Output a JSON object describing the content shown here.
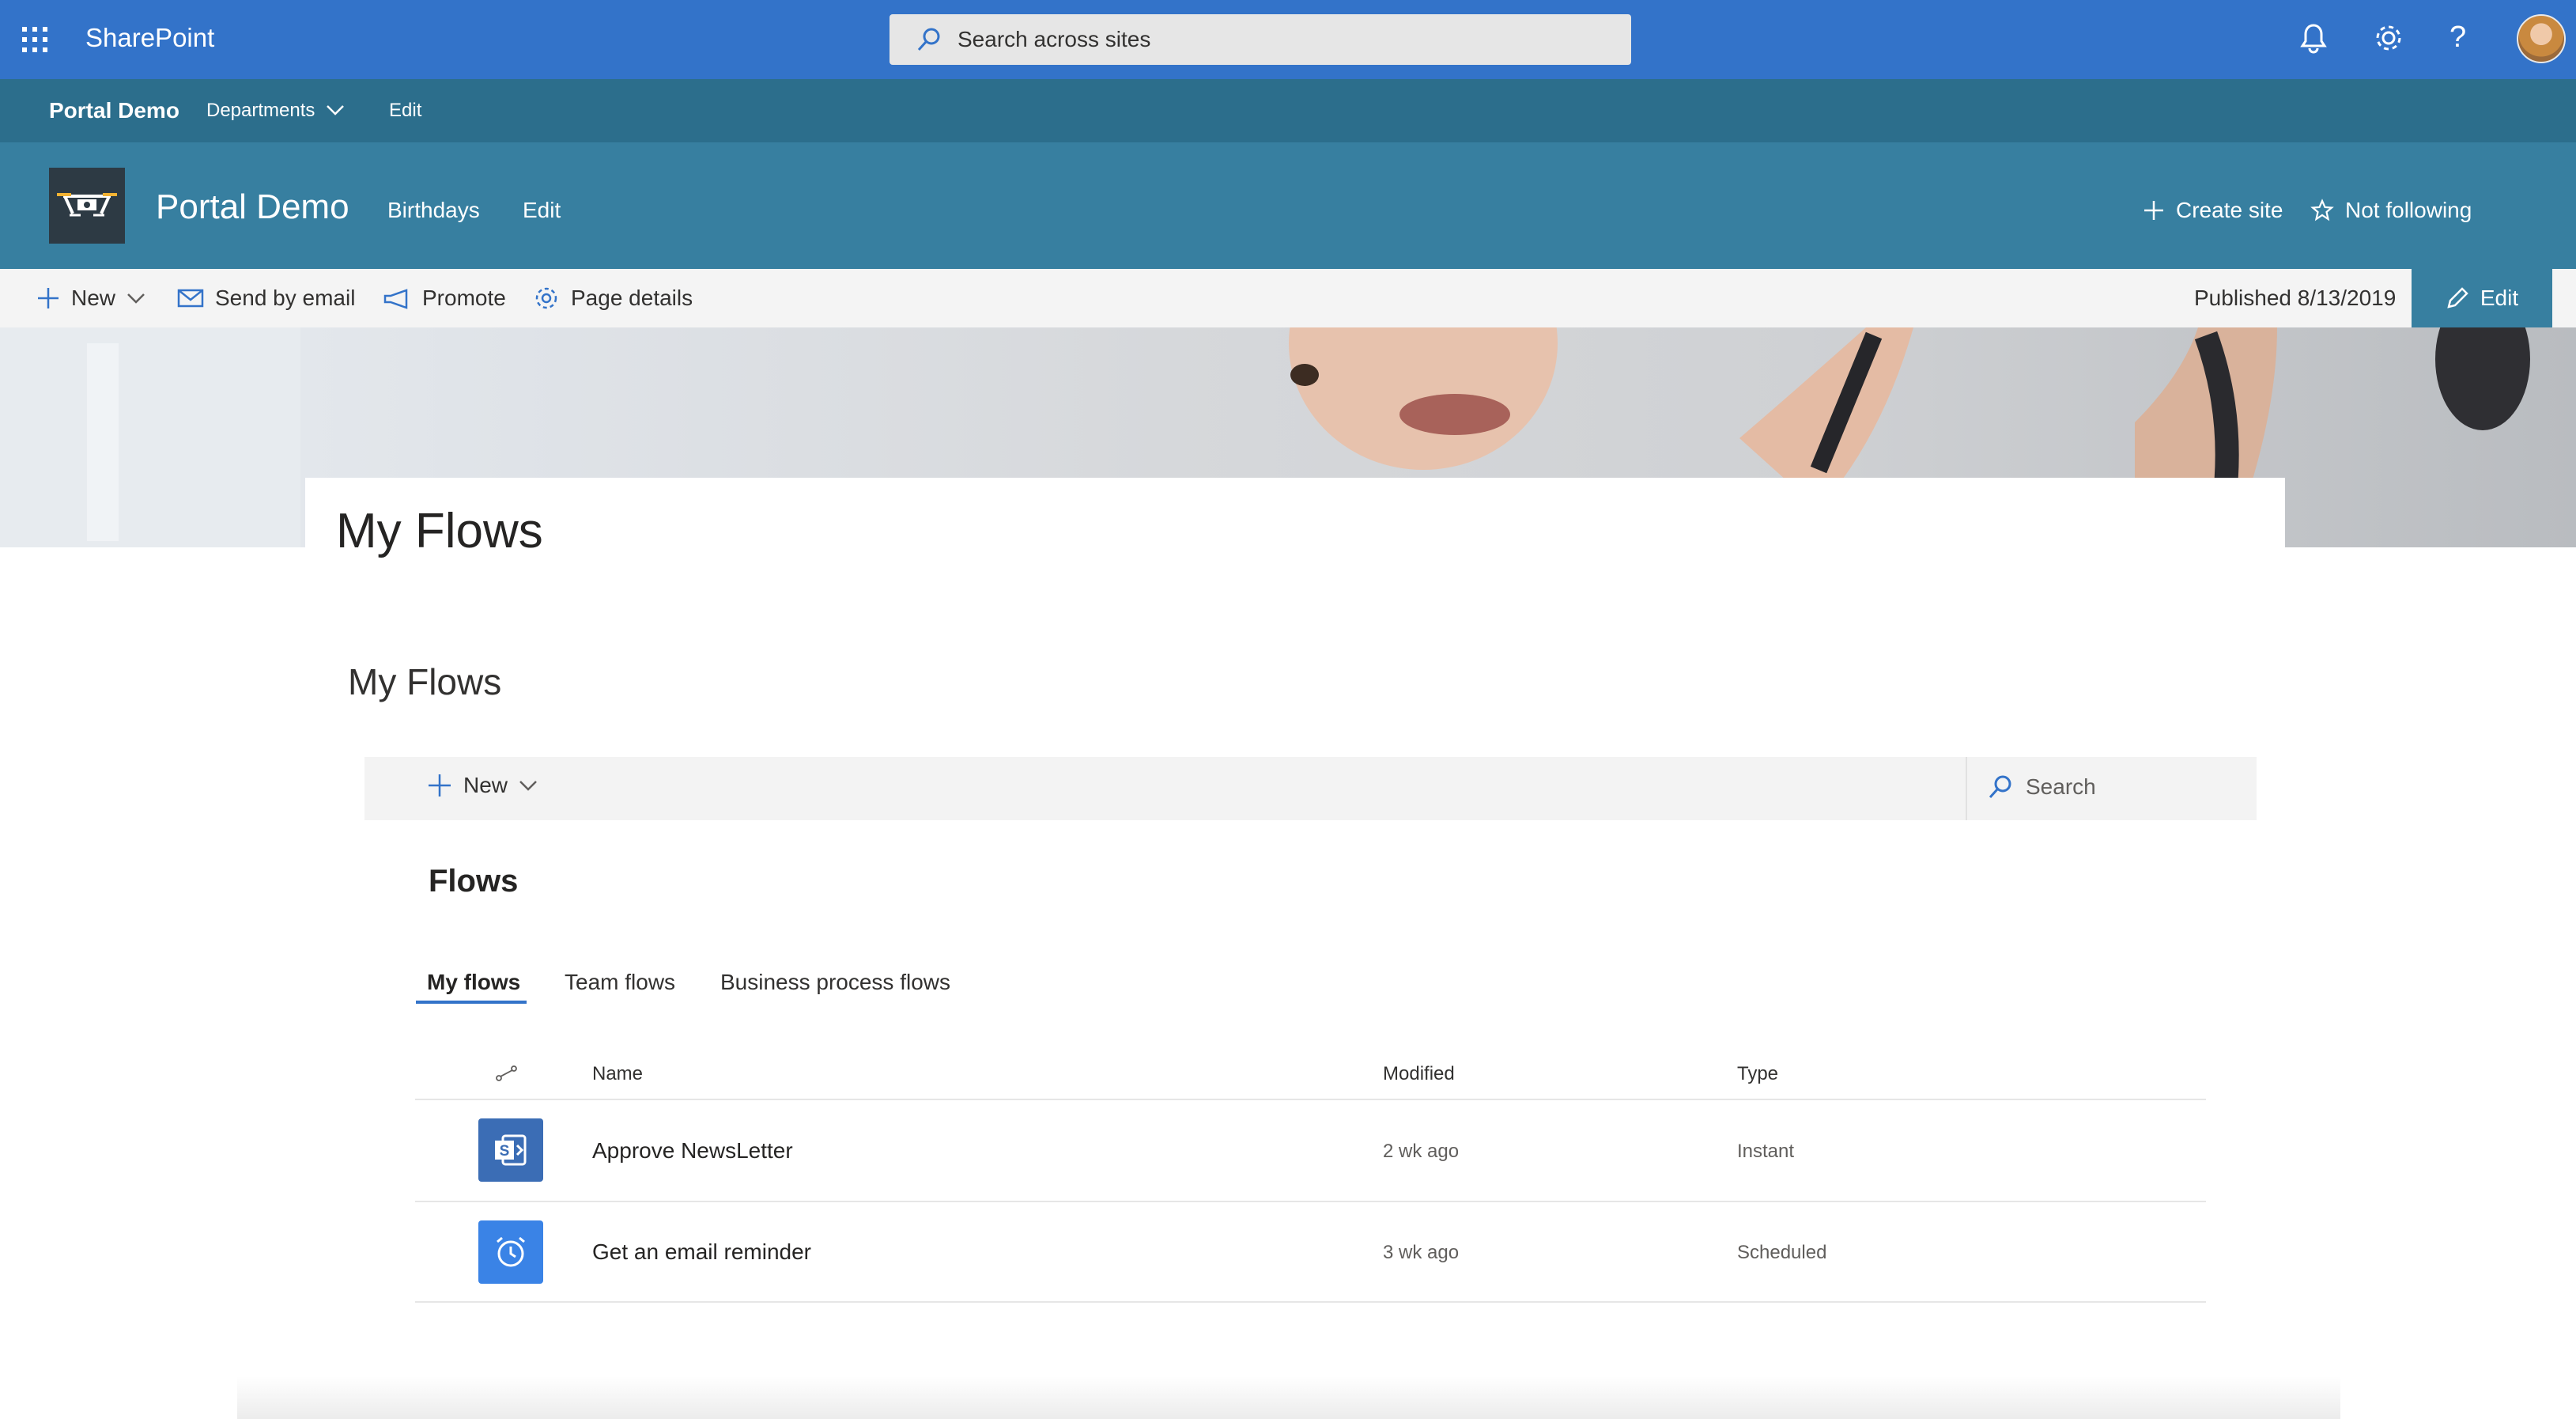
{
  "suite": {
    "brand": "SharePoint",
    "search_placeholder": "Search across sites",
    "help_glyph": "?"
  },
  "hub": {
    "title": "Portal Demo",
    "departments": "Departments",
    "edit": "Edit"
  },
  "site": {
    "title": "Portal Demo",
    "nav": [
      "Birthdays",
      "Edit"
    ],
    "create_site": "Create site",
    "not_following": "Not following"
  },
  "commandbar": {
    "new": "New",
    "send_by_email": "Send by email",
    "promote": "Promote",
    "page_details": "Page details",
    "published": "Published 8/13/2019",
    "edit": "Edit"
  },
  "page": {
    "title": "My Flows"
  },
  "webpart": {
    "title": "My Flows",
    "new": "New",
    "search": "Search",
    "heading": "Flows",
    "tabs": [
      "My flows",
      "Team flows",
      "Business process flows"
    ],
    "columns": {
      "name": "Name",
      "modified": "Modified",
      "type": "Type"
    },
    "rows": [
      {
        "name": "Approve NewsLetter",
        "modified": "2 wk ago",
        "type": "Instant",
        "icon": "sharepoint-icon",
        "color": "#3b6db5"
      },
      {
        "name": "Get an email reminder",
        "modified": "3 wk ago",
        "type": "Scheduled",
        "icon": "alarm-clock-icon",
        "color": "#3a83e6"
      }
    ]
  },
  "colors": {
    "suite_bar": "#3373c9",
    "hub_bar": "#2c6e8c",
    "site_header": "#377fa0",
    "accent": "#3373c9"
  }
}
